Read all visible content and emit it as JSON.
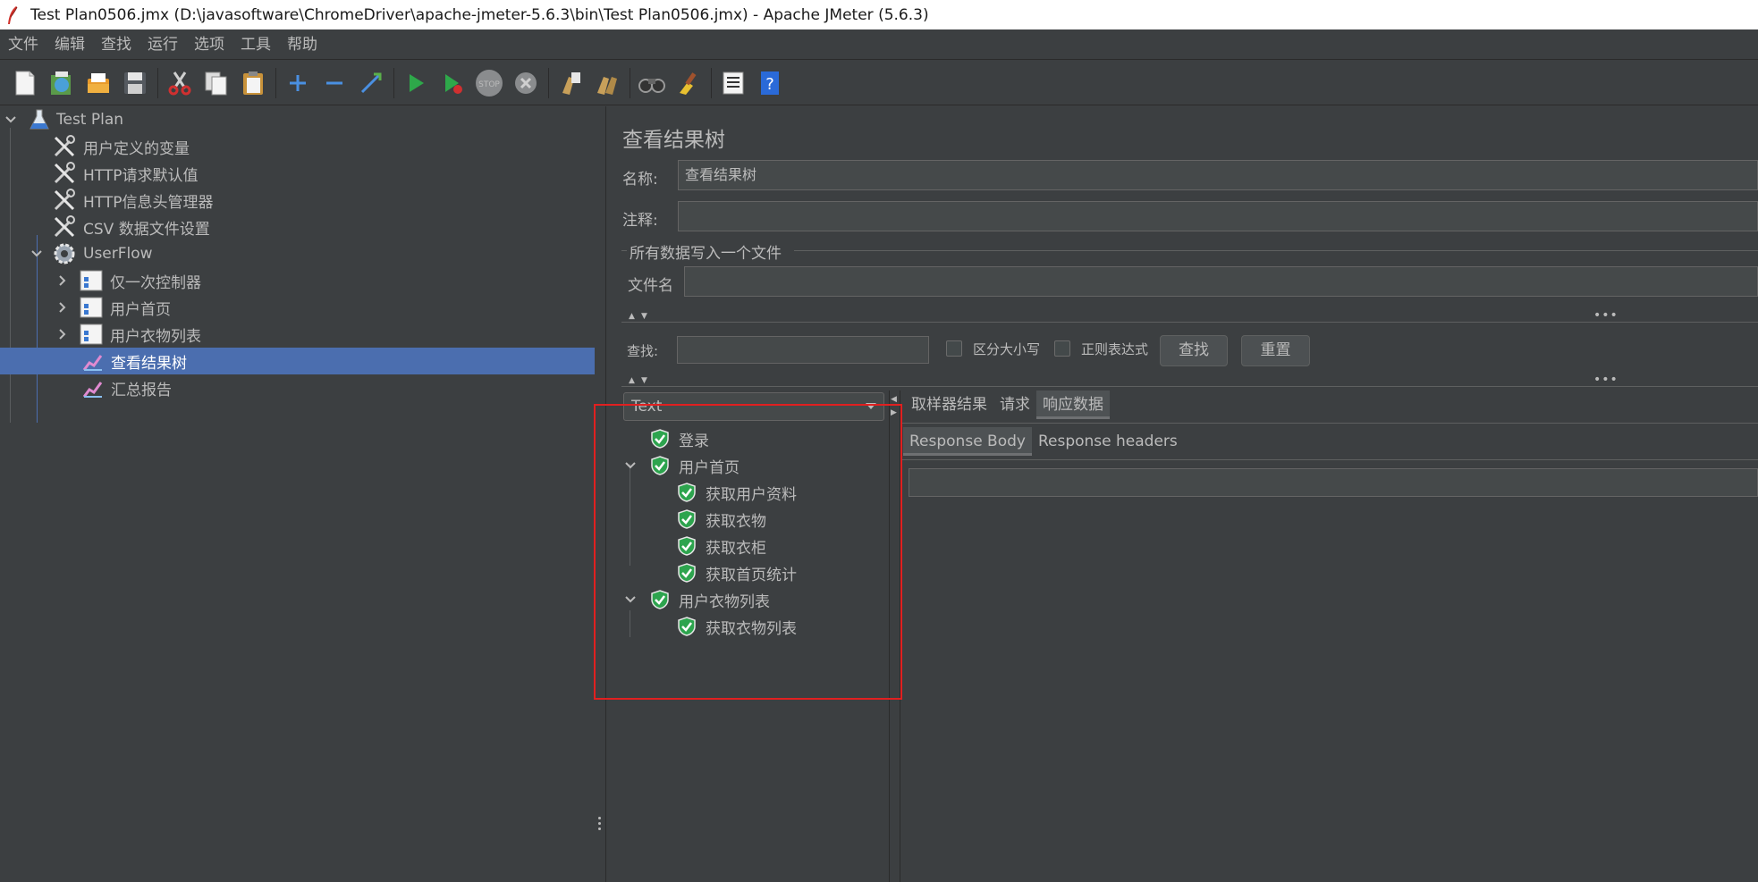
{
  "window": {
    "title": "Test Plan0506.jmx (D:\\javasoftware\\ChromeDriver\\apache-jmeter-5.6.3\\bin\\Test Plan0506.jmx) - Apache JMeter (5.6.3)"
  },
  "menu": [
    "文件",
    "编辑",
    "查找",
    "运行",
    "选项",
    "工具",
    "帮助"
  ],
  "toolbar": {
    "icons": [
      "new-icon",
      "templates-icon",
      "open-icon",
      "save-icon",
      "cut-icon",
      "copy-icon",
      "paste-icon",
      "expand-icon",
      "collapse-icon",
      "toggle-icon",
      "start-icon",
      "start-no-pause-icon",
      "stop-icon",
      "shutdown-icon",
      "clear-icon",
      "clear-all-icon",
      "search-icon",
      "reset-search-icon",
      "function-helper-icon",
      "help-icon"
    ]
  },
  "tree": {
    "root": "Test Plan",
    "config": [
      "用户定义的变量",
      "HTTP请求默认值",
      "HTTP信息头管理器",
      "CSV 数据文件设置"
    ],
    "thread_group": "UserFlow",
    "controllers": [
      "仅一次控制器",
      "用户首页",
      "用户衣物列表"
    ],
    "listeners": [
      "查看结果树",
      "汇总报告"
    ]
  },
  "panel": {
    "title": "查看结果树",
    "name_label": "名称:",
    "name_value": "查看结果树",
    "comment_label": "注释:",
    "comment_value": "",
    "file_group_label": "所有数据写入一个文件",
    "filename_label": "文件名",
    "filename_value": ""
  },
  "search": {
    "label": "查找:",
    "value": "",
    "case_label": "区分大小写",
    "regex_label": "正则表达式",
    "find_button": "查找",
    "reset_button": "重置"
  },
  "results": {
    "renderer": "Text",
    "items": [
      {
        "label": "登录",
        "level": 0,
        "expandable": false
      },
      {
        "label": "用户首页",
        "level": 0,
        "expandable": true
      },
      {
        "label": "获取用户资料",
        "level": 1,
        "expandable": false
      },
      {
        "label": "获取衣物",
        "level": 1,
        "expandable": false
      },
      {
        "label": "获取衣柜",
        "level": 1,
        "expandable": false
      },
      {
        "label": "获取首页统计",
        "level": 1,
        "expandable": false
      },
      {
        "label": "用户衣物列表",
        "level": 0,
        "expandable": true
      },
      {
        "label": "获取衣物列表",
        "level": 1,
        "expandable": false
      }
    ]
  },
  "detail_tabs": [
    "取样器结果",
    "请求",
    "响应数据"
  ],
  "response_tabs": [
    "Response Body",
    "Response headers"
  ],
  "colors": {
    "background": "#3c3f41",
    "selection": "#4b6eaf",
    "annotation_box": "#e02020",
    "success_icon": "#2da44e"
  }
}
